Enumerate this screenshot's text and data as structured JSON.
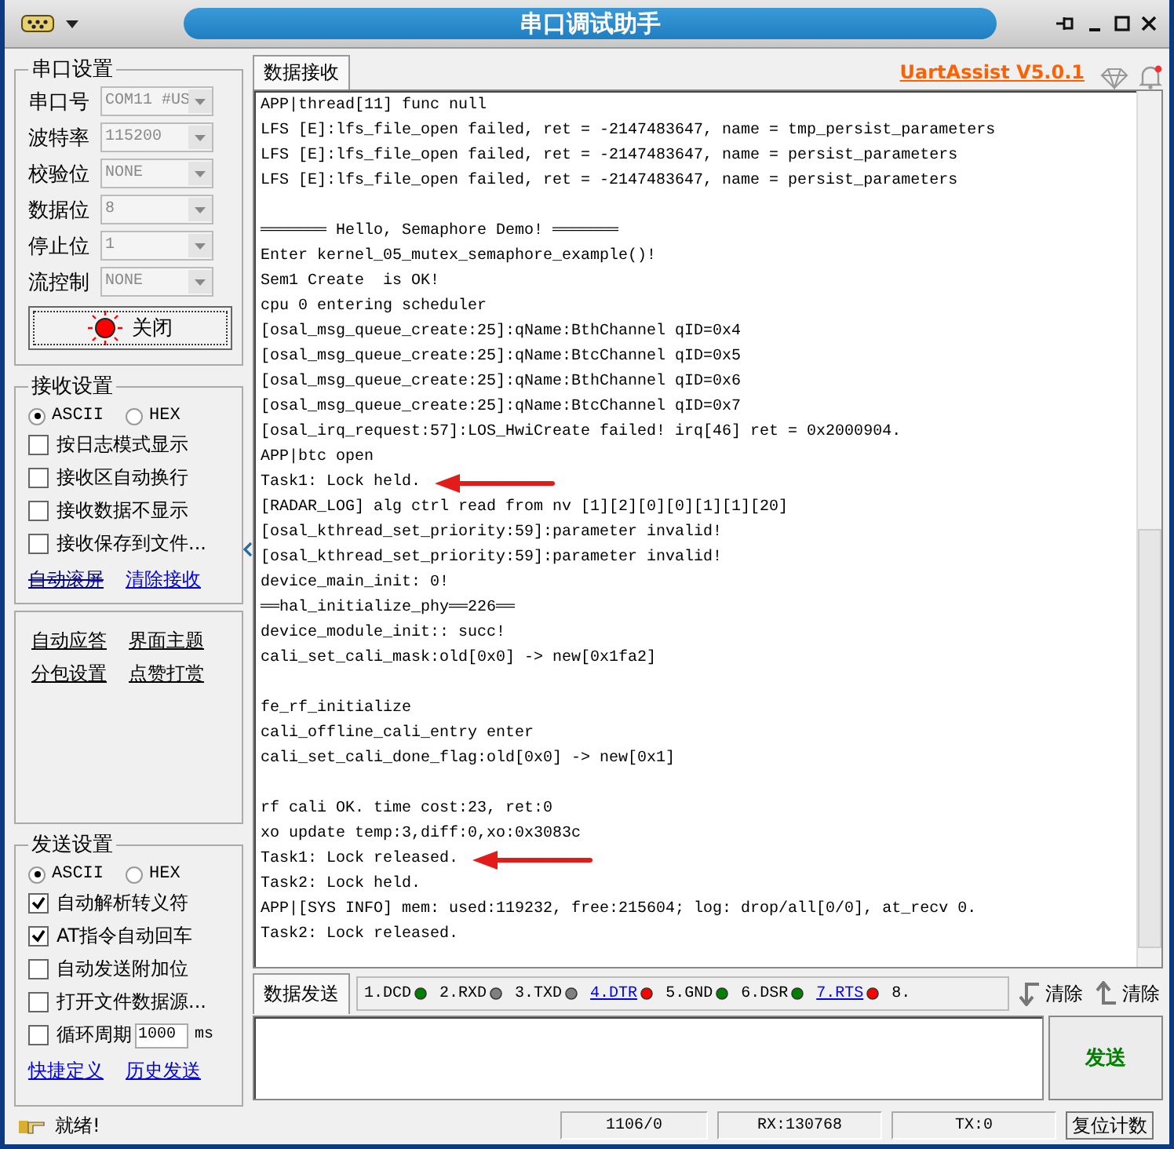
{
  "window": {
    "title": "串口调试助手"
  },
  "brand_link": "UartAssist V5.0.1",
  "serial_settings": {
    "title": "串口设置",
    "fields": [
      {
        "label": "串口号",
        "value": "COM11 #US",
        "disabled": true
      },
      {
        "label": "波特率",
        "value": "115200",
        "disabled": true
      },
      {
        "label": "校验位",
        "value": "NONE",
        "disabled": true
      },
      {
        "label": "数据位",
        "value": "8",
        "disabled": true
      },
      {
        "label": "停止位",
        "value": "1",
        "disabled": true
      },
      {
        "label": "流控制",
        "value": "NONE",
        "disabled": true
      }
    ],
    "port_button": {
      "label": "关闭",
      "on": true
    }
  },
  "receive_settings": {
    "title": "接收设置",
    "modes": [
      {
        "label": "ASCII",
        "selected": true
      },
      {
        "label": "HEX",
        "selected": false
      }
    ],
    "options": [
      {
        "label": "按日志模式显示",
        "checked": false
      },
      {
        "label": "接收区自动换行",
        "checked": false
      },
      {
        "label": "接收数据不显示",
        "checked": false
      },
      {
        "label": "接收保存到文件...",
        "checked": false
      }
    ],
    "links": [
      {
        "label": "自动滚屏",
        "struck": true
      },
      {
        "label": "清除接收",
        "struck": false
      }
    ]
  },
  "extra_links": [
    "自动应答",
    "界面主题",
    "分包设置",
    "点赞打赏"
  ],
  "send_settings": {
    "title": "发送设置",
    "modes": [
      {
        "label": "ASCII",
        "selected": true
      },
      {
        "label": "HEX",
        "selected": false
      }
    ],
    "options": [
      {
        "label": "自动解析转义符",
        "checked": true
      },
      {
        "label": "AT指令自动回车",
        "checked": true
      },
      {
        "label": "自动发送附加位",
        "checked": false
      },
      {
        "label": "打开文件数据源...",
        "checked": false
      }
    ],
    "cycle": {
      "label": "循环周期",
      "checked": false,
      "value": "1000",
      "unit": "ms"
    },
    "links": [
      "快捷定义",
      "历史发送"
    ]
  },
  "receive_tab": "数据接收",
  "log": [
    {
      "text": "APP|thread[11] func null",
      "arrow": false
    },
    {
      "text": "LFS [E]:lfs_file_open failed, ret = -2147483647, name = tmp_persist_parameters",
      "arrow": false
    },
    {
      "text": "LFS [E]:lfs_file_open failed, ret = -2147483647, name = persist_parameters",
      "arrow": false
    },
    {
      "text": "LFS [E]:lfs_file_open failed, ret = -2147483647, name = persist_parameters",
      "arrow": false
    },
    {
      "arrow": false
    },
    {
      "text": "═══════ Hello, Semaphore Demo! ═══════",
      "arrow": false
    },
    {
      "text": "Enter kernel_05_mutex_semaphore_example()!",
      "arrow": false
    },
    {
      "text": "Sem1 Create  is OK!",
      "arrow": false
    },
    {
      "text": "cpu 0 entering scheduler",
      "arrow": false
    },
    {
      "text": "[osal_msg_queue_create:25]:qName:BthChannel qID=0x4",
      "arrow": false
    },
    {
      "text": "[osal_msg_queue_create:25]:qName:BtcChannel qID=0x5",
      "arrow": false
    },
    {
      "text": "[osal_msg_queue_create:25]:qName:BthChannel qID=0x6",
      "arrow": false
    },
    {
      "text": "[osal_msg_queue_create:25]:qName:BtcChannel qID=0x7",
      "arrow": false
    },
    {
      "text": "[osal_irq_request:57]:LOS_HwiCreate failed! irq[46] ret = 0x2000904.",
      "arrow": false
    },
    {
      "text": "APP|btc open",
      "arrow": false
    },
    {
      "text": "Task1: Lock held.",
      "arrow": true
    },
    {
      "text": "[RADAR_LOG] alg ctrl read from nv [1][2][0][0][1][1][20]",
      "arrow": false
    },
    {
      "text": "[osal_kthread_set_priority:59]:parameter invalid!",
      "arrow": false
    },
    {
      "text": "[osal_kthread_set_priority:59]:parameter invalid!",
      "arrow": false
    },
    {
      "text": "device_main_init: 0!",
      "arrow": false
    },
    {
      "text": "══hal_initialize_phy══226══",
      "arrow": false
    },
    {
      "text": "device_module_init:: succ!",
      "arrow": false
    },
    {
      "text": "cali_set_cali_mask:old[0x0] -> new[0x1fa2]",
      "arrow": false
    },
    {
      "arrow": false
    },
    {
      "text": "fe_rf_initialize",
      "arrow": false
    },
    {
      "text": "cali_offline_cali_entry enter",
      "arrow": false
    },
    {
      "text": "cali_set_cali_done_flag:old[0x0] -> new[0x1]",
      "arrow": false
    },
    {
      "arrow": false
    },
    {
      "text": "rf cali OK. time cost:23, ret:0",
      "arrow": false
    },
    {
      "text": "xo update temp:3,diff:0,xo:0x3083c",
      "arrow": false
    },
    {
      "text": "Task1: Lock released.",
      "arrow": true
    },
    {
      "text": "Task2: Lock held.",
      "arrow": false
    },
    {
      "text": "APP|[SYS INFO] mem: used:119232, free:215604; log: drop/all[0/0], at_recv 0.",
      "arrow": false
    },
    {
      "text": "Task2: Lock released.",
      "arrow": false
    }
  ],
  "send_tab": "数据发送",
  "pins": [
    {
      "label": "1.DCD",
      "color": "#008000",
      "link": false
    },
    {
      "label": "2.RXD",
      "color": "#808080",
      "link": false
    },
    {
      "label": "3.TXD",
      "color": "#808080",
      "link": false
    },
    {
      "label": "4.DTR",
      "color": "#ff0000",
      "link": true
    },
    {
      "label": "5.GND",
      "color": "#008000",
      "link": false
    },
    {
      "label": "6.DSR",
      "color": "#008000",
      "link": false
    },
    {
      "label": "7.RTS",
      "color": "#ff0000",
      "link": true
    },
    {
      "label": "8.",
      "link": false
    }
  ],
  "clear_buttons": [
    {
      "label": "清除",
      "kind": "send"
    },
    {
      "label": "清除",
      "kind": "receive"
    }
  ],
  "send_button": "发送",
  "status_bar": {
    "message": "就绪!",
    "counts": "1106/0",
    "rx": "RX:130768",
    "tx": "TX:0",
    "reset_button": "复位计数"
  }
}
